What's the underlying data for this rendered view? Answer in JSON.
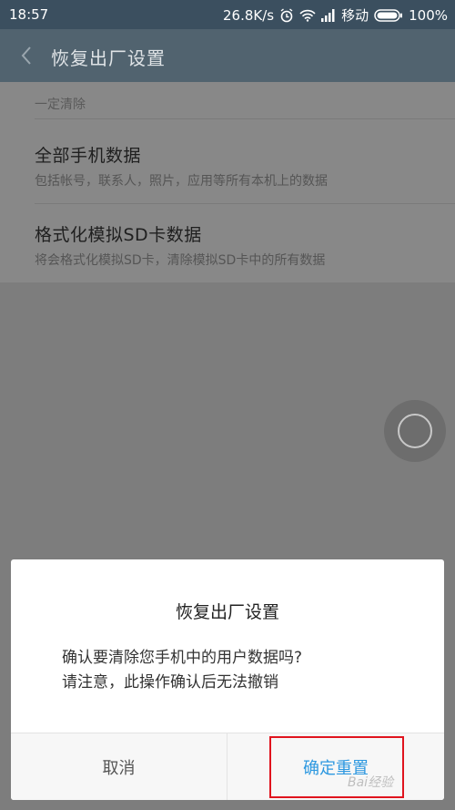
{
  "status_bar": {
    "time": "18:57",
    "speed": "26.8K/s",
    "carrier": "移动",
    "battery": "100%"
  },
  "header": {
    "title": "恢复出厂设置"
  },
  "section": {
    "label": "一定清除"
  },
  "items": [
    {
      "title": "全部手机数据",
      "desc": "包括帐号，联系人，照片，应用等所有本机上的数据"
    },
    {
      "title": "格式化模拟SD卡数据",
      "desc": "将会格式化模拟SD卡，清除模拟SD卡中的所有数据"
    }
  ],
  "dialog": {
    "title": "恢复出厂设置",
    "message_line1": "确认要清除您手机中的用户数据吗?",
    "message_line2": "请注意，此操作确认后无法撤销",
    "cancel_label": "取消",
    "confirm_label": "确定重置"
  },
  "watermark": "Bai经验",
  "colors": {
    "accent": "#2d98e0",
    "highlight": "#e0141e",
    "titlebar": "#51636f"
  }
}
